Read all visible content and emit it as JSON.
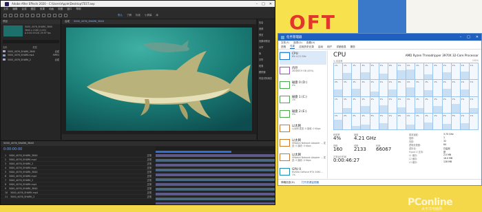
{
  "wallpaper": {
    "text": "OFT"
  },
  "ae": {
    "title": "Adobe After Effects 2020 - C:\\Users\\Apple\\Desktop\\TEST.aep",
    "menu": [
      "文件",
      "编辑",
      "合成",
      "图层",
      "效果",
      "动画",
      "视图",
      "窗口",
      "帮助"
    ],
    "workspaces": [
      "默认",
      "了解",
      "标准",
      "小屏幕",
      "库"
    ],
    "active_workspace": "默认",
    "project_tab": "项目",
    "project_clip_name": "5000_4076_SHARK_3840",
    "project_clip_info": "3840 x 2160 (1.00)",
    "project_clip_info2": "Δ 0:00:19:28, 29.97 fps",
    "project_columns": [
      "名称",
      "类型"
    ],
    "project_items": [
      {
        "name": "5000_4076_SHARK_3840",
        "type": "合成",
        "color": "#a9a2d8"
      },
      {
        "name": "5000_4076_SHARK.mp4",
        "type": "MPEG",
        "color": "#7aa3c9"
      },
      {
        "name": "5000_4076_SHARK_2",
        "type": "合成",
        "color": "#a9a2d8"
      }
    ],
    "viewer_tabs": [
      "合成",
      "5000_4076_SHARK_3840"
    ],
    "right_items": [
      "信息",
      "音频",
      "预览",
      "效果和预设",
      "对齐",
      "库",
      "字符",
      "段落",
      "跟踪器",
      "内容识别填充"
    ],
    "timeline_tab": "5000_4076_SHARK_3840",
    "timeline_time": "0:00:00:00",
    "layers": [
      {
        "num": "1",
        "name": "5000_4076_SHARK_3840",
        "mode": "正常"
      },
      {
        "num": "2",
        "name": "5000_4076_SHARK.mp4",
        "mode": "正常"
      },
      {
        "num": "3",
        "name": "5000_4076_SHARK_2",
        "mode": "正常"
      },
      {
        "num": "4",
        "name": "5000_4076_SHARK.mp4",
        "mode": "正常"
      },
      {
        "num": "5",
        "name": "5000_4076_SHARK_3840",
        "mode": "正常"
      },
      {
        "num": "6",
        "name": "5000_4076_SHARK.mp4",
        "mode": "正常"
      },
      {
        "num": "7",
        "name": "5000_4076_SHARK_2",
        "mode": "正常"
      },
      {
        "num": "8",
        "name": "5000_4076_SHARK.mp4",
        "mode": "正常"
      },
      {
        "num": "9",
        "name": "5000_4076_SHARK_3840",
        "mode": "正常"
      },
      {
        "num": "10",
        "name": "5000_4076_SHARK.mp4",
        "mode": "正常"
      },
      {
        "num": "11",
        "name": "5000_4076_SHARK_2",
        "mode": "正常"
      }
    ]
  },
  "tm": {
    "title": "任务管理器",
    "menu": [
      "文件(F)",
      "选项(O)",
      "查看(V)"
    ],
    "tabs": [
      "进程",
      "性能",
      "应用历史记录",
      "启动",
      "用户",
      "详细信息",
      "服务"
    ],
    "active_tab": "性能",
    "sidebar": [
      {
        "name": "CPU",
        "sub": "8% 4.21 GHz",
        "color": "#1a73c9",
        "selected": true
      },
      {
        "name": "内存",
        "sub": "28.6/63.9 GB (45%)",
        "color": "#9a4dbd",
        "selected": false
      },
      {
        "name": "磁盘 0 (D:)",
        "sub": "0%",
        "color": "#4ca84c",
        "selected": false
      },
      {
        "name": "磁盘 1 (C:)",
        "sub": "1%",
        "color": "#4ca84c",
        "selected": false
      },
      {
        "name": "磁盘 2 (E:)",
        "sub": "0%",
        "color": "#4ca84c",
        "selected": false
      },
      {
        "name": "以太网",
        "sub": "以太网 发送: 0 接收: 0 Kbps",
        "color": "#c77a2b",
        "selected": false
      },
      {
        "name": "以太网",
        "sub": "VMware Network Adapter ... 发送: 0 接收: 0 Kbps",
        "color": "#c77a2b",
        "selected": false
      },
      {
        "name": "以太网",
        "sub": "VMware Network Adapter ... 发送: 0 接收: 0 Kbps",
        "color": "#c77a2b",
        "selected": false
      },
      {
        "name": "GPU 0",
        "sub": "NVIDIA GeForce RTX 2080 ... 1%",
        "color": "#1a8ab5",
        "selected": false
      }
    ],
    "main_title": "CPU",
    "cpu_model": "AMD Ryzen Threadripper 3970X 32-Core Processor",
    "graph_label": "% 利用率",
    "graph_label_right": "100%",
    "cores": [
      1,
      1,
      1,
      1,
      1,
      1,
      0,
      1,
      1,
      1,
      1,
      2,
      1,
      1,
      1,
      1,
      2,
      1,
      1,
      1,
      1,
      1,
      1,
      0,
      1,
      1,
      1,
      1,
      1,
      1,
      1,
      1,
      1,
      1,
      1,
      1,
      1,
      1,
      1,
      1,
      1,
      1,
      1,
      1,
      1,
      1,
      1,
      1,
      1,
      2,
      2,
      1,
      3,
      1,
      1,
      0,
      1,
      1,
      1,
      1,
      2,
      3,
      1,
      1
    ],
    "core_fill_pct": [
      0,
      40,
      0,
      45,
      0,
      35,
      0,
      55,
      60,
      0,
      30,
      0,
      45,
      0,
      50,
      0,
      40,
      0,
      45,
      0,
      30,
      0,
      40,
      0,
      55,
      0,
      35,
      0,
      45,
      0,
      40,
      0,
      0,
      30,
      0,
      40,
      0,
      45,
      0,
      35,
      0,
      30,
      0,
      40,
      0,
      55,
      0,
      30,
      60,
      0,
      20,
      30,
      0,
      40,
      0,
      0,
      30,
      0,
      45,
      0,
      35,
      0,
      40,
      0
    ],
    "stats": {
      "util_label": "利用率",
      "util_value": "4%",
      "speed_label": "速度",
      "speed_value": "4.21 GHz",
      "proc_label": "进程",
      "proc_value": "160",
      "threads_label": "线程",
      "threads_value": "2133",
      "handles_label": "句柄",
      "handles_value": "66067",
      "uptime_label": "正常运行时间",
      "uptime_value": "0:00:46:27"
    },
    "specs": [
      {
        "label": "基准速度:",
        "value": "3.70 GHz"
      },
      {
        "label": "插槽:",
        "value": "1"
      },
      {
        "label": "内核:",
        "value": "32"
      },
      {
        "label": "逻辑处理器:",
        "value": "64"
      },
      {
        "label": "虚拟化:",
        "value": "已启用"
      },
      {
        "label": "Hyper-V 支持:",
        "value": "是"
      },
      {
        "label": "L1 缓存:",
        "value": "2.0 MB"
      },
      {
        "label": "L2 缓存:",
        "value": "16.0 MB"
      },
      {
        "label": "L3 缓存:",
        "value": "128 MB"
      }
    ],
    "footer_less": "简略信息(D)",
    "footer_open": "打开资源监视器"
  },
  "watermark": {
    "main": "PConline",
    "sub": "太平洋电脑网"
  }
}
